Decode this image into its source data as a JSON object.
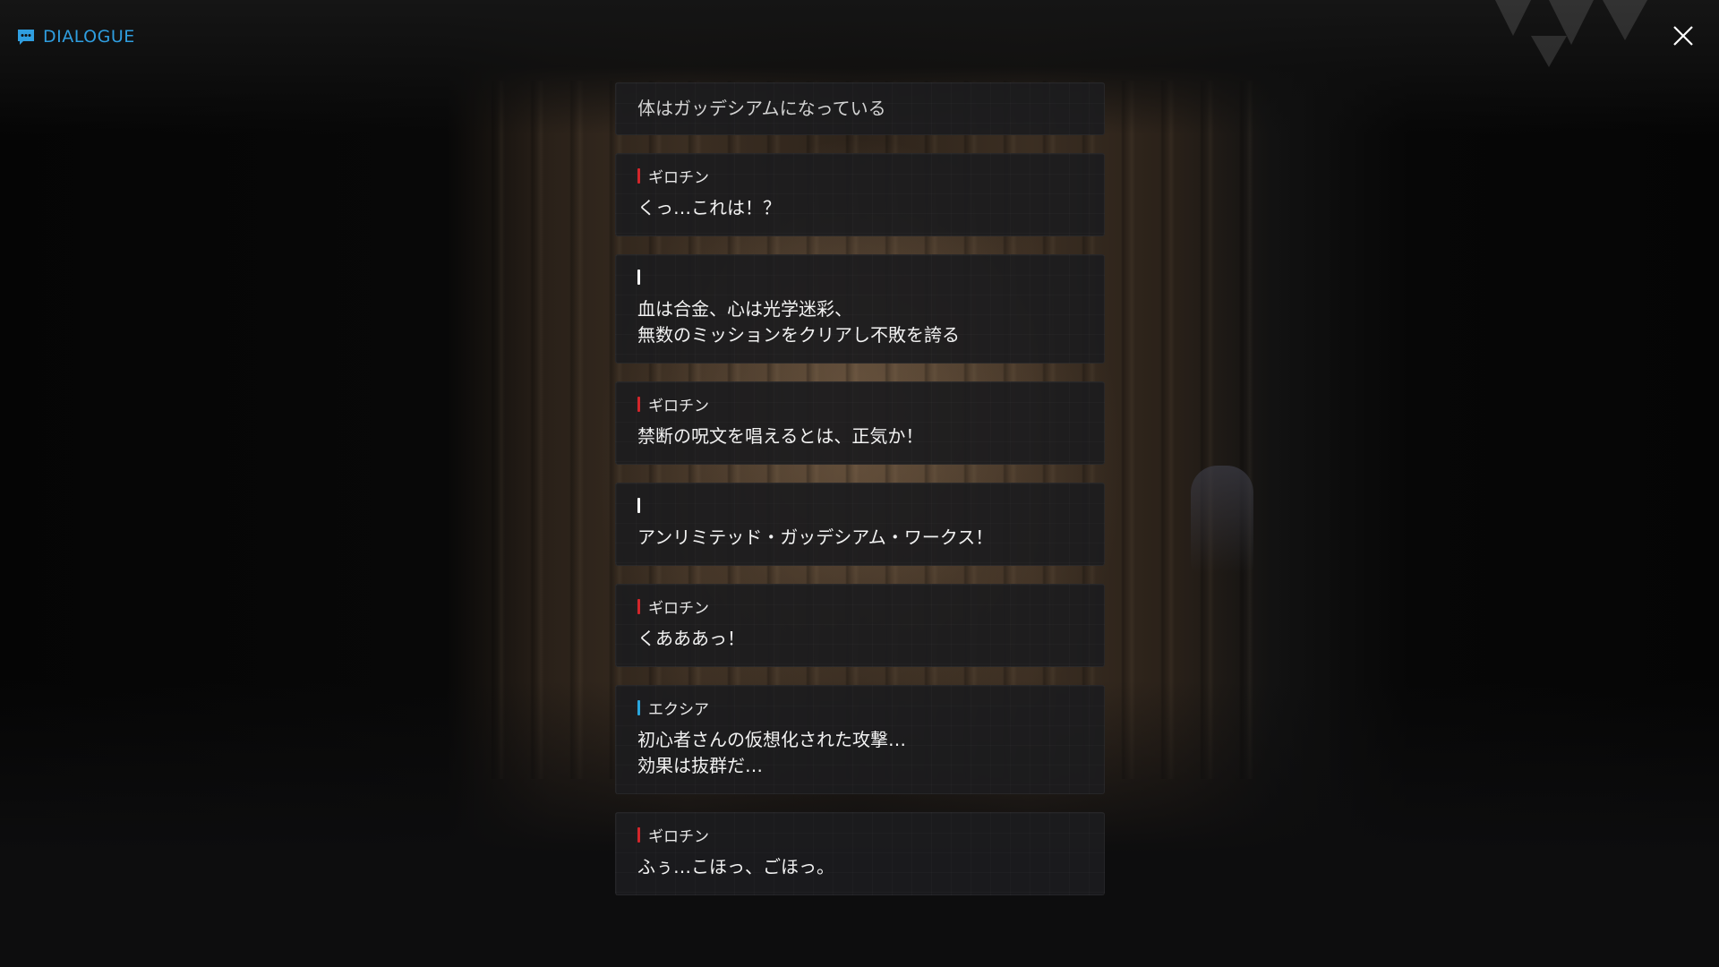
{
  "header": {
    "title": "DIALOGUE",
    "icon": "chat-icon"
  },
  "close": {
    "icon": "close-icon"
  },
  "colors": {
    "accent": "#2f9ee0",
    "speaker_red": "#d3262b",
    "speaker_blue": "#2aa6dd",
    "speaker_white": "#ffffff"
  },
  "entries": [
    {
      "type": "narration",
      "speaker": "",
      "text": "体はガッデシアムになっている"
    },
    {
      "type": "speech",
      "speaker": "ギロチン",
      "bar": "red",
      "text": "くっ…これは！？"
    },
    {
      "type": "speech",
      "speaker": "",
      "bar": "white",
      "text": "血は合金、心は光学迷彩、\n無数のミッションをクリアし不敗を誇る"
    },
    {
      "type": "speech",
      "speaker": "ギロチン",
      "bar": "red",
      "text": "禁断の呪文を唱えるとは、正気か！"
    },
    {
      "type": "speech",
      "speaker": "",
      "bar": "white",
      "text": "アンリミテッド・ガッデシアム・ワークス！"
    },
    {
      "type": "speech",
      "speaker": "ギロチン",
      "bar": "red",
      "text": "くあああっ！"
    },
    {
      "type": "speech",
      "speaker": "エクシア",
      "bar": "blue",
      "text": "初心者さんの仮想化された攻撃…\n効果は抜群だ…"
    },
    {
      "type": "speech",
      "speaker": "ギロチン",
      "bar": "red",
      "text": "ふぅ…こほっ、ごほっ。"
    }
  ]
}
